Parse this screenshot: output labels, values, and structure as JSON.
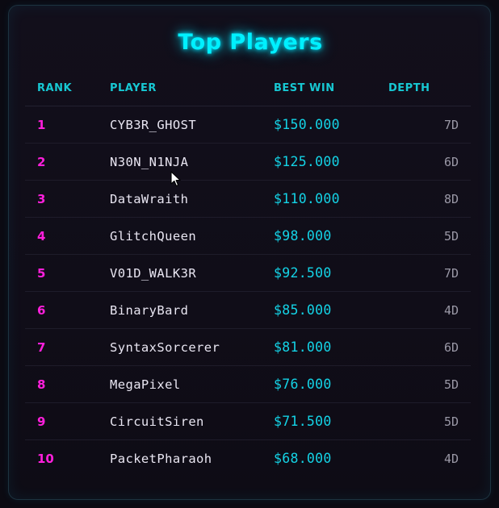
{
  "title": "Top Players",
  "columns": {
    "rank": "RANK",
    "player": "PLAYER",
    "best_win": "BEST WIN",
    "depth": "DEPTH"
  },
  "rows": [
    {
      "rank": "1",
      "player": "CYB3R_GHOST",
      "best_win": "$150.000",
      "depth": "7D"
    },
    {
      "rank": "2",
      "player": "N30N_N1NJA",
      "best_win": "$125.000",
      "depth": "6D"
    },
    {
      "rank": "3",
      "player": "DataWraith",
      "best_win": "$110.000",
      "depth": "8D"
    },
    {
      "rank": "4",
      "player": "GlitchQueen",
      "best_win": "$98.000",
      "depth": "5D"
    },
    {
      "rank": "5",
      "player": "V01D_WALK3R",
      "best_win": "$92.500",
      "depth": "7D"
    },
    {
      "rank": "6",
      "player": "BinaryBard",
      "best_win": "$85.000",
      "depth": "4D"
    },
    {
      "rank": "7",
      "player": "SyntaxSorcerer",
      "best_win": "$81.000",
      "depth": "6D"
    },
    {
      "rank": "8",
      "player": "MegaPixel",
      "best_win": "$76.000",
      "depth": "5D"
    },
    {
      "rank": "9",
      "player": "CircuitSiren",
      "best_win": "$71.500",
      "depth": "5D"
    },
    {
      "rank": "10",
      "player": "PacketPharaoh",
      "best_win": "$68.000",
      "depth": "4D"
    }
  ],
  "colors": {
    "title": "#00f0ff",
    "header": "#17c8d3",
    "rank": "#ff1fdc",
    "player": "#e9e6f2",
    "best_win": "#14d3e6",
    "depth": "#9a98a6"
  }
}
